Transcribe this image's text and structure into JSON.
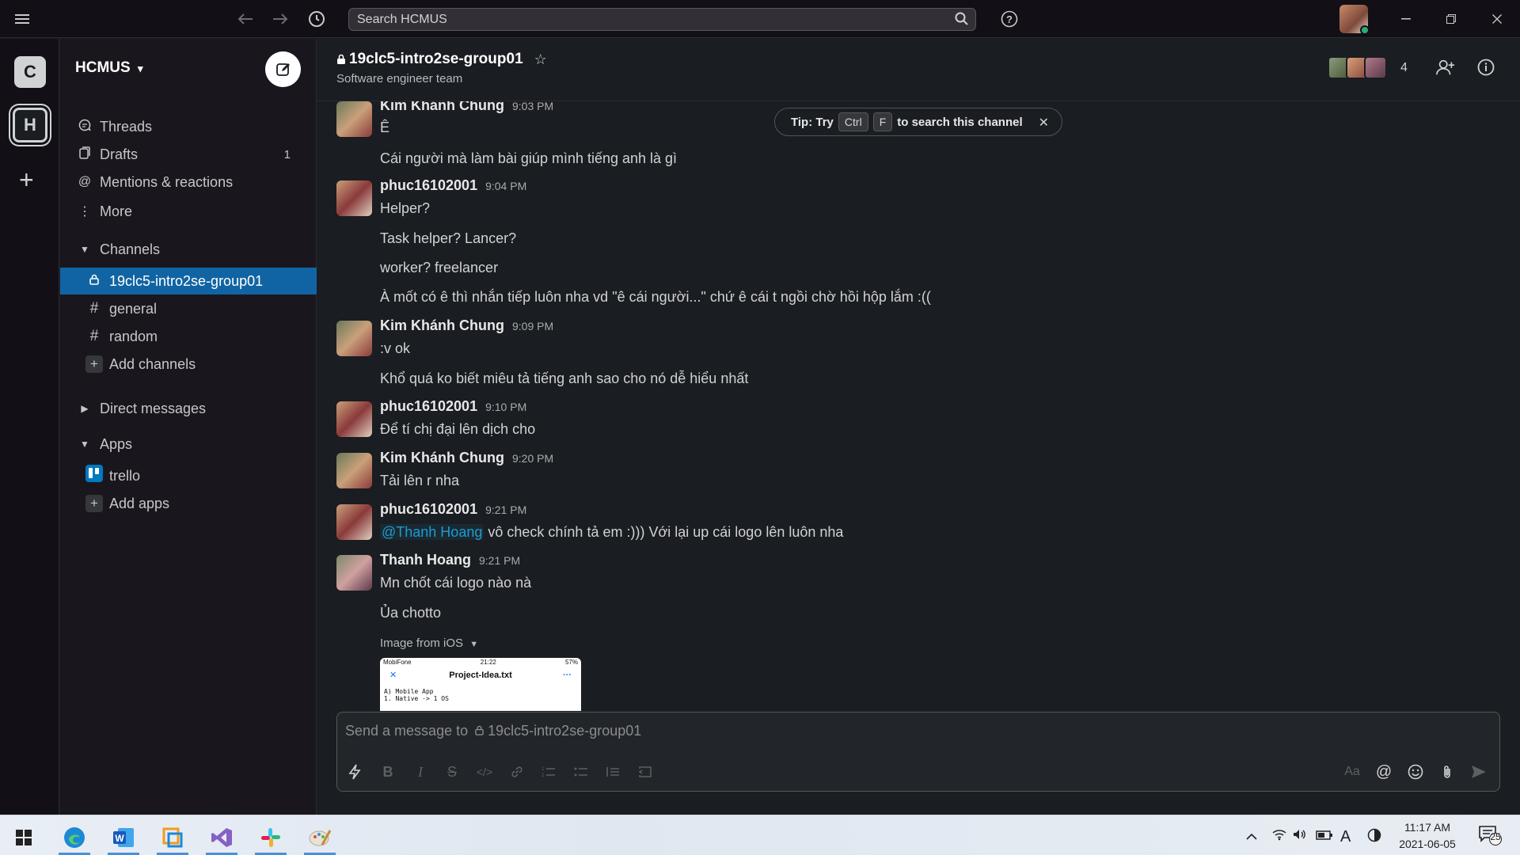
{
  "search": {
    "placeholder": "Search HCMUS"
  },
  "workspaces": [
    {
      "initial": "C"
    },
    {
      "initial": "H"
    }
  ],
  "sidebar": {
    "workspace_name": "HCMUS",
    "nav": [
      {
        "label": "Threads",
        "icon": "threads-icon"
      },
      {
        "label": "Drafts",
        "icon": "drafts-icon",
        "count": "1"
      },
      {
        "label": "Mentions & reactions",
        "icon": "at-icon"
      },
      {
        "label": "More",
        "icon": "more-vertical-icon"
      }
    ],
    "sections": {
      "channels": "Channels",
      "direct_messages": "Direct messages",
      "apps": "Apps"
    },
    "channels": [
      {
        "name": "19clc5-intro2se-group01",
        "private": true,
        "active": true
      },
      {
        "name": "general",
        "private": false,
        "active": false
      },
      {
        "name": "random",
        "private": false,
        "active": false
      }
    ],
    "add_channels": "Add channels",
    "apps": [
      {
        "name": "trello"
      }
    ],
    "add_apps": "Add apps"
  },
  "channel": {
    "name": "19clc5-intro2se-group01",
    "topic": "Software engineer team",
    "member_count": "4"
  },
  "tip": {
    "prefix": "Tip: Try",
    "key1": "Ctrl",
    "key2": "F",
    "suffix": "to search this channel"
  },
  "messages": [
    {
      "author": "Kim Khánh Chung",
      "time": "9:03 PM",
      "lines": [
        "Ê",
        "Cái người mà làm bài giúp mình tiếng anh là gì"
      ]
    },
    {
      "author": "phuc16102001",
      "time": "9:04 PM",
      "lines": [
        "Helper?",
        "Task helper? Lancer?",
        "worker? freelancer",
        "À mốt có ê thì nhắn tiếp luôn nha vd \"ê cái người...\" chứ ê cái t ngồi chờ hồi hộp lắm :(("
      ]
    },
    {
      "author": "Kim Khánh Chung",
      "time": "9:09 PM",
      "lines": [
        ":v ok",
        "Khổ quá ko biết miêu tả tiếng anh sao cho nó dễ hiểu nhất"
      ]
    },
    {
      "author": "phuc16102001",
      "time": "9:10 PM",
      "lines": [
        "Để tí chị đại lên dịch cho"
      ]
    },
    {
      "author": "Kim Khánh Chung",
      "time": "9:20 PM",
      "lines": [
        "Tải lên r nha"
      ]
    },
    {
      "author": "phuc16102001",
      "time": "9:21 PM",
      "mention": "@Thanh Hoang",
      "lines": [
        "vô check chính tả em :))) Với lại up cái logo lên luôn nha"
      ]
    },
    {
      "author": "Thanh Hoang",
      "time": "9:21 PM",
      "lines": [
        "Mn chốt cái logo nào nà",
        "Ủa chotto"
      ]
    }
  ],
  "attachment": {
    "label": "Image from iOS",
    "carrier": "MobiFone",
    "phone_time": "21:22",
    "battery": "57%",
    "file_title": "Project-Idea.txt",
    "line1": "A) Mobile App",
    "line2": "1. Native -> 1 OS"
  },
  "composer": {
    "placeholder_prefix": "Send a message to",
    "placeholder_channel": "19clc5-intro2se-group01",
    "text_style_label": "Aa"
  },
  "taskbar": {
    "time": "11:17 AM",
    "date": "2021-06-05",
    "ime": "A",
    "notifications": "25"
  },
  "colors": {
    "active_channel": "#1164a3",
    "presence": "#2bac76",
    "mention": "#1d9bd1"
  }
}
